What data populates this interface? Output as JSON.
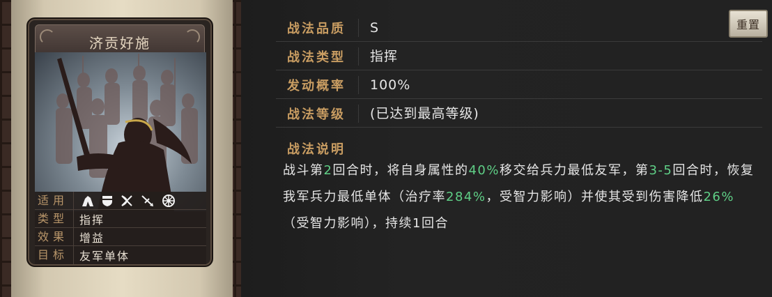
{
  "card": {
    "title": "济贡好施",
    "rows": [
      {
        "label": "适用",
        "value": ""
      },
      {
        "label": "类型",
        "value": "指挥"
      },
      {
        "label": "效果",
        "value": "增益"
      },
      {
        "label": "目标",
        "value": "友军单体"
      }
    ],
    "troop_icons": [
      "cavalry-icon",
      "shield-icon",
      "archer-icon",
      "spear-icon",
      "siege-wheel-icon"
    ]
  },
  "info": {
    "quality_label": "战法品质",
    "quality_value": "S",
    "type_label": "战法类型",
    "type_value": "指挥",
    "rate_label": "发动概率",
    "rate_value": "100%",
    "level_label": "战法等级",
    "level_value": "(已达到最高等级)",
    "reset_label": "重置"
  },
  "description": {
    "title": "战法说明",
    "segments": [
      {
        "text": "战斗第",
        "hl": false
      },
      {
        "text": "2",
        "hl": true
      },
      {
        "text": "回合时，将自身属性的",
        "hl": false
      },
      {
        "text": "40%",
        "hl": true
      },
      {
        "text": "移交给兵力最低友军，第",
        "hl": false
      },
      {
        "text": "3-5",
        "hl": true
      },
      {
        "text": "回合时，恢复我军兵力最低单体（治疗率",
        "hl": false
      },
      {
        "text": "284%",
        "hl": true
      },
      {
        "text": "，受智力影响）并使其受到伤害降低",
        "hl": false
      },
      {
        "text": "26%",
        "hl": true
      },
      {
        "text": "（受智力影响），持续1回合",
        "hl": false
      }
    ]
  },
  "colors": {
    "label_gold": "#c99d62",
    "highlight_green": "#5fcf86",
    "text_light": "#e6e6e6"
  }
}
